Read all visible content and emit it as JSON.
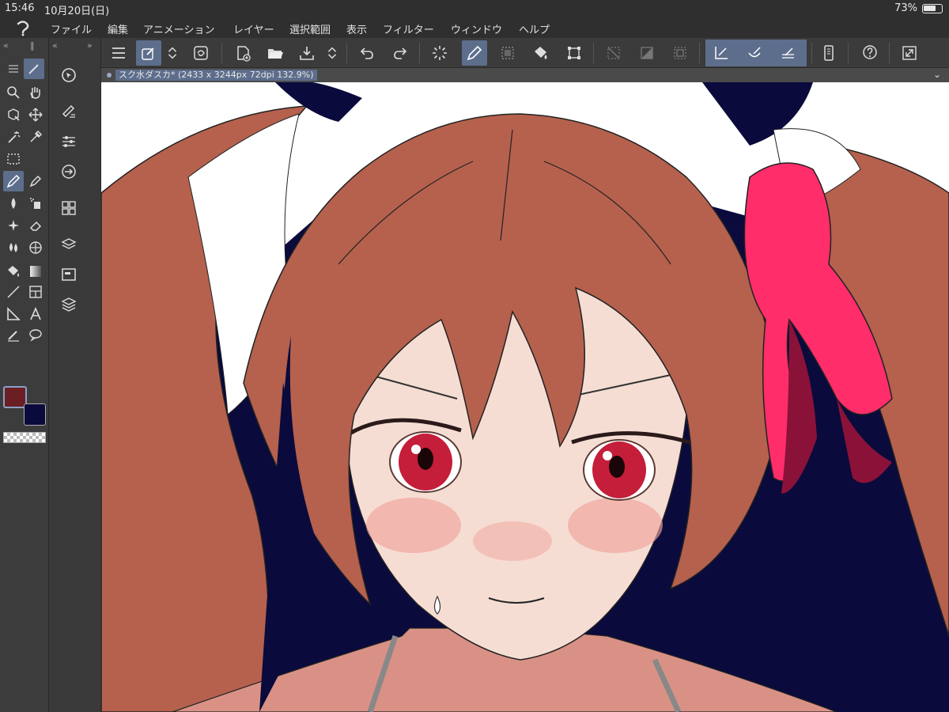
{
  "status": {
    "time": "15:46",
    "date": "10月20日(日)",
    "battery": "73%"
  },
  "menu": [
    "ファイル",
    "編集",
    "アニメーション",
    "レイヤー",
    "選択範囲",
    "表示",
    "フィルター",
    "ウィンドウ",
    "ヘルプ"
  ],
  "canvas_tab": {
    "title": "スク水ダスカ* (2433 x 3244px 72dpi 132.9%)"
  },
  "colors": {
    "main": "#6b1f22",
    "sub": "#0a0a3c",
    "accent": "#5d6d8c"
  },
  "left_tools": [
    "zoom-icon",
    "hand-icon",
    "object-select-icon",
    "move-icon",
    "auto-select-wand-icon",
    "eyedropper-icon",
    "selection-marquee-icon",
    "pen-icon",
    "pencil-icon",
    "brush-icon",
    "airbrush-icon",
    "decoration-icon",
    "eraser-icon",
    "blend-icon",
    "mesh-icon",
    "fill-icon",
    "gradient-icon",
    "line-icon",
    "frame-icon",
    "ruler-icon",
    "text-icon",
    "correction-brush-icon",
    "balloon-icon"
  ],
  "sub_tools": [
    "navigator-icon",
    "brush-settings-icon",
    "tool-property-icon",
    "material-icon",
    "layer-property-icon",
    "sub-tool-detail-icon",
    "layers-icon",
    "layer-stack-icon"
  ],
  "toolbar": [
    "menu-icon",
    "quick-access-icon",
    "modify-icon",
    "new-file-icon",
    "open-icon",
    "save-icon",
    "undo-icon",
    "redo-icon",
    "clear-icon",
    "pen-active-icon",
    "select-all-icon",
    "fill-icon",
    "transform-icon",
    "deselect-icon",
    "invert-selection-icon",
    "selection-border-icon",
    "snap-ruler-icon",
    "snap-special-icon",
    "snap-grid-icon",
    "smartphone-icon",
    "help-icon",
    "fullscreen-icon"
  ]
}
